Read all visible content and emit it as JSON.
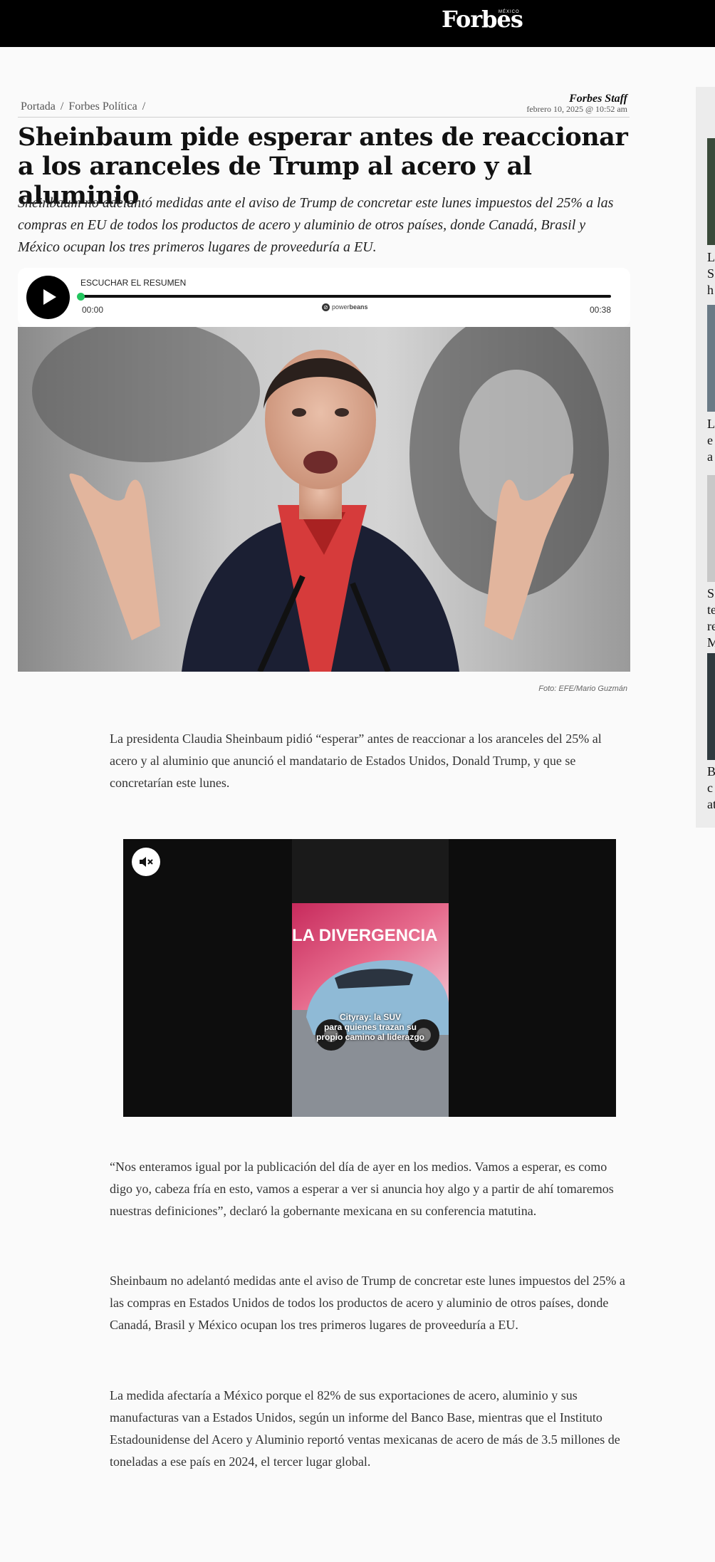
{
  "header": {
    "logo": "Forbes",
    "logo_sub": "MÉXICO"
  },
  "breadcrumb": {
    "items": [
      "Portada",
      "Forbes Política"
    ],
    "separator": "/"
  },
  "byline": {
    "author": "Forbes Staff",
    "date": "febrero 10, 2025 @ 10:52 am"
  },
  "article": {
    "headline": "Sheinbaum pide esperar antes de reaccionar a los aranceles de Trump al acero y al aluminio",
    "dek": "Sheinbaum no adelantó medidas ante el aviso de Trump de concretar este lunes impuestos del 25% a las compras en EU de todos los productos de acero y aluminio de otros países, donde Canadá, Brasil y México ocupan los tres primeros lugares de proveeduría a EU.",
    "photo_caption": "Foto: EFE/Mario Guzmán",
    "paragraphs": [
      "La presidenta Claudia Sheinbaum pidió “esperar” antes de reaccionar a los aranceles del 25% al acero y al aluminio que anunció el mandatario de Estados Unidos, Donald Trump, y que se concretarían este lunes.",
      "“Nos enteramos igual por la publicación del día de ayer en los medios. Vamos a esperar, es como digo yo, cabeza fría en esto, vamos a esperar a ver si anuncia hoy algo y a partir de ahí tomaremos nuestras definiciones”, declaró la gobernante mexicana en su conferencia matutina.",
      "Sheinbaum no adelantó medidas ante el aviso de Trump de concretar este lunes impuestos del 25% a las compras en Estados Unidos de todos los productos de acero y aluminio de otros países, donde Canadá, Brasil y México ocupan los tres primeros lugares de proveeduría a EU.",
      "La medida afectaría a México porque el 82% de sus exportaciones de acero, aluminio y sus manufacturas van a Estados Unidos, según un informe del Banco Base, mientras que el Instituto Estadounidense del Acero y Aluminio reportó ventas mexicanas de acero de más de 3.5 millones de toneladas a ese país en 2024, el tercer lugar global."
    ]
  },
  "audio_player": {
    "label": "ESCUCHAR EL RESUMEN",
    "current_time": "00:00",
    "duration": "00:38",
    "progress": 0,
    "brand_prefix": "power",
    "brand_bold": "beans"
  },
  "video": {
    "sign_text": "LA DIVERGENCIA",
    "caption_lines": [
      "Cityray: la SUV",
      "para quienes trazan su",
      "propio camino al liderazgo"
    ]
  },
  "sidebar": {
    "items": [
      {
        "lines": [
          "L",
          "S",
          "h"
        ]
      },
      {
        "lines": [
          "L",
          "e",
          "a"
        ]
      },
      {
        "lines": [
          "S",
          "te",
          "re",
          "M"
        ]
      },
      {
        "lines": [
          "B",
          "c",
          "at"
        ]
      }
    ]
  },
  "colors": {
    "topbar": "#000000",
    "accent_progress": "#22c55e",
    "scarf": "#d63b3b"
  }
}
